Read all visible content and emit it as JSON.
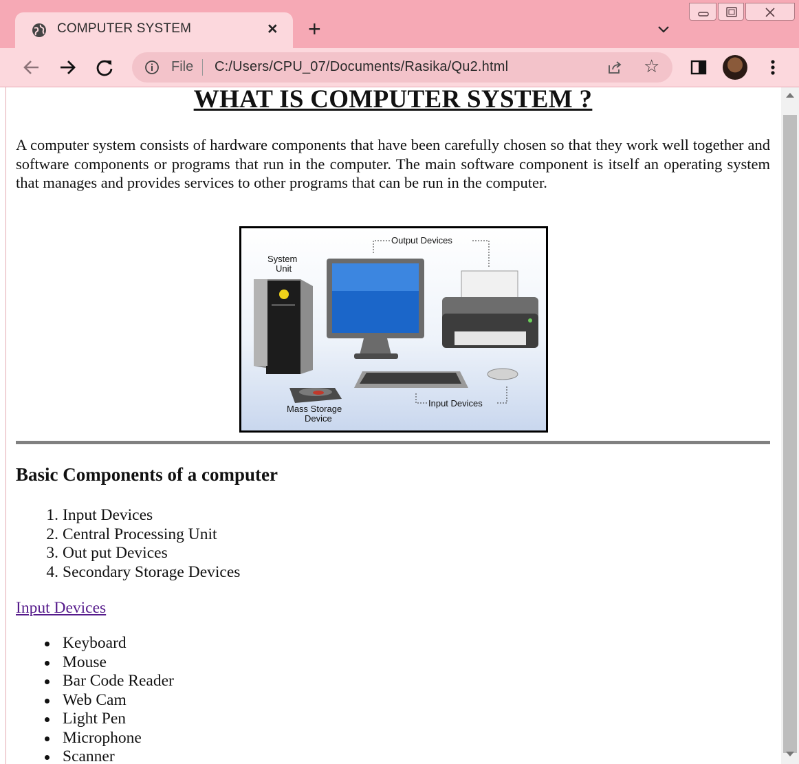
{
  "browser": {
    "tab": {
      "title": "COMPUTER SYSTEM",
      "icon": "globe-icon"
    },
    "address_bar": {
      "scheme_label": "File",
      "url": "C:/Users/CPU_07/Documents/Rasika/Qu2.html"
    },
    "colors": {
      "tabstrip": "#f6a9b5",
      "toolbar": "#fcd8dd",
      "omnibox": "#f3c3ca"
    }
  },
  "page": {
    "title": "WHAT IS COMPUTER SYSTEM ?",
    "intro": "A computer system consists of hardware components that have been carefully chosen so that they work well together and software components or programs that run in the computer. The main software component is itself an operating system that manages and provides services to other programs that can be run in the computer.",
    "figure": {
      "labels": {
        "output": "Output Devices",
        "system_unit_1": "System",
        "system_unit_2": "Unit",
        "input": "Input Devices",
        "mass_storage_1": "Mass Storage",
        "mass_storage_2": "Device"
      }
    },
    "section_heading": "Basic Components of a computer",
    "components": [
      {
        "num": "1.",
        "label": "Input Devices"
      },
      {
        "num": "2.",
        "label": "Central Processing Unit"
      },
      {
        "num": "3.",
        "label": "Out put Devices"
      },
      {
        "num": "4.",
        "label": "Secondary Storage Devices"
      }
    ],
    "link": "Input Devices",
    "input_devices": [
      "Keyboard",
      "Mouse",
      "Bar Code Reader",
      "Web Cam",
      "Light Pen",
      "Microphone",
      "Scanner"
    ],
    "link_color": "#551a8b"
  }
}
